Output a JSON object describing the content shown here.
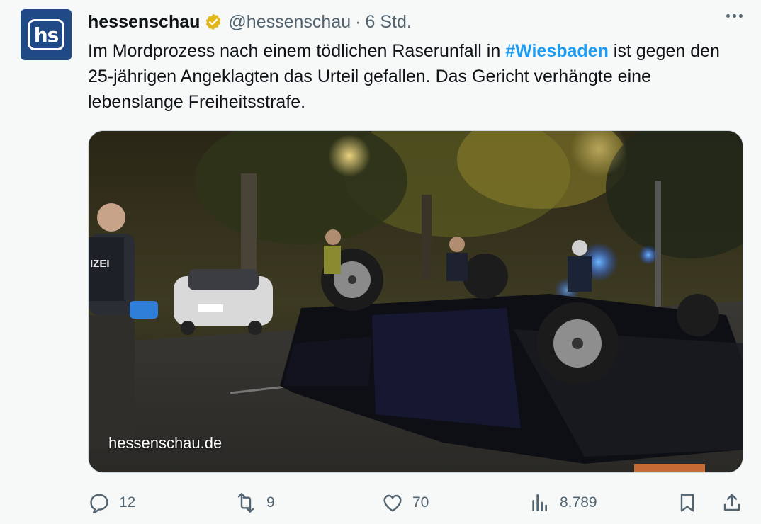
{
  "tweet": {
    "author_name": "hessenschau",
    "avatar_text": "hs",
    "handle": "@hessenschau",
    "separator": "·",
    "time": "6 Std.",
    "text_part1": "Im Mordprozess nach einem tödlichen Raserunfall in ",
    "hashtag": "#Wiesbaden",
    "text_part2": " ist gegen den 25-jährigen Angeklagten das Urteil gefallen. Das Gericht verhängte eine lebenslange Freiheitsstrafe.",
    "media_watermark": "hessenschau.de",
    "police_label": "IZEI"
  },
  "actions": {
    "replies": "12",
    "reposts": "9",
    "likes": "70",
    "views": "8.789"
  },
  "colors": {
    "hashtag": "#1d9bf0",
    "muted": "#536471",
    "verified_gold": "#e2b719",
    "avatar_bg": "#1f4a86"
  },
  "icons": [
    "verified-badge-icon",
    "more-icon",
    "reply-icon",
    "repost-icon",
    "like-icon",
    "views-icon",
    "bookmark-icon",
    "share-icon"
  ]
}
